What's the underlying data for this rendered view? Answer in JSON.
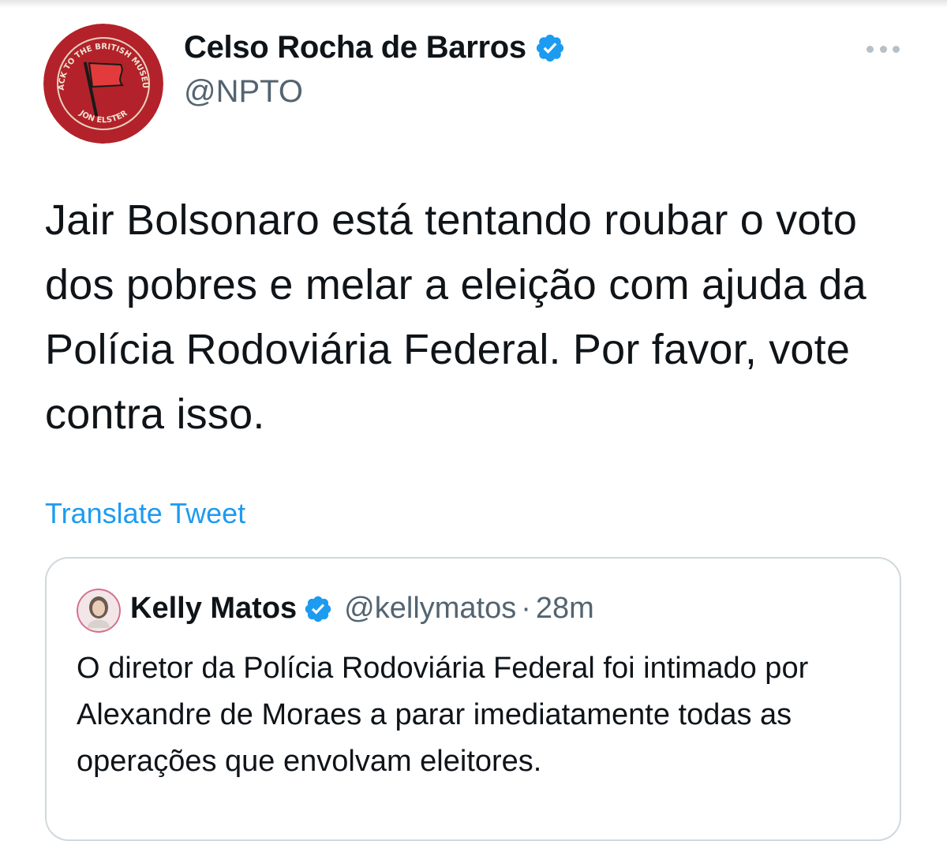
{
  "tweet": {
    "author": {
      "display_name": "Celso Rocha de Barros",
      "handle": "@NPTO",
      "verified": true,
      "avatar_text_top": "BACK TO THE BRITISH MUSEUM",
      "avatar_text_bottom": "JON ELSTER"
    },
    "text": "Jair Bolsonaro está tentando roubar o voto dos pobres e melar a eleição com ajuda da Polícia Rodoviária Federal. Por favor, vote contra isso.",
    "translate_label": "Translate Tweet",
    "more_icon": "more-horizontal-icon"
  },
  "quoted_tweet": {
    "display_name": "Kelly Matos",
    "verified": true,
    "handle": "@kellymatos",
    "separator": "·",
    "time": "28m",
    "text": "O diretor da Polícia Rodoviária Federal foi intimado por Alexandre de Moraes a parar imediatamente todas as operações que envolvam eleitores."
  },
  "colors": {
    "accent": "#1d9bf0",
    "secondary_text": "#536471",
    "border": "#cfd9de",
    "avatar_red": "#b3222a"
  }
}
